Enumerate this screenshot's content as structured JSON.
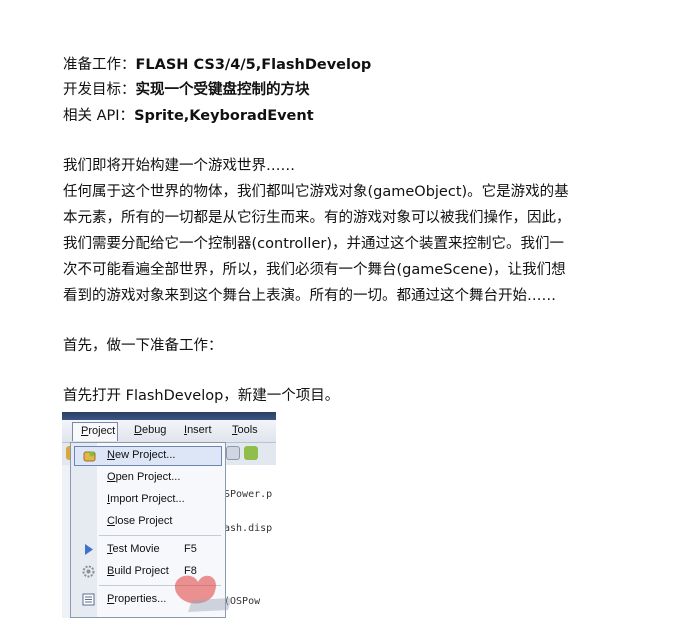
{
  "header": {
    "prep_label": "准备工作：",
    "prep_value": "FLASH CS3/4/5,FlashDevelop",
    "goal_label": "开发目标：",
    "goal_value": "实现一个受键盘控制的方块",
    "api_label": "相关 API：",
    "api_value": "Sprite,KeyboradEvent"
  },
  "intro": [
    "我们即将开始构建一个游戏世界……",
    "任何属于这个世界的物体，我们都叫它游戏对象(gameObject)。它是游戏的基",
    "本元素，所有的一切都是从它衍生而来。有的游戏对象可以被我们操作，因此，",
    "我们需要分配给它一个控制器(controller)，并通过这个装置来控制它。我们一",
    "次不可能看遍全部世界，所以，我们必须有一个舞台(gameScene)，让我们想",
    "看到的游戏对象来到这个舞台上表演。所有的一切。都通过这个舞台开始……"
  ],
  "first_prep": "首先，做一下准备工作：",
  "open_fd": "首先打开 FlashDevelop，新建一个项目。",
  "screenshot": {
    "menubar": {
      "project_first": "P",
      "project_rest": "roject",
      "debug_first": "D",
      "debug_rest": "ebug",
      "insert_first": "I",
      "insert_rest": "nsert",
      "tools_first": "T",
      "tools_rest": "ools"
    },
    "editor_lines": [
      "SPower.p",
      "ash.disp",
      "(OSPow"
    ],
    "menu": {
      "new_first": "N",
      "new_rest": "ew Project...",
      "open_first": "O",
      "open_rest": "pen Project...",
      "import_first": "I",
      "import_rest": "mport Project...",
      "close_first": "C",
      "close_rest": "lose Project",
      "test_first": "T",
      "test_rest": "est Movie",
      "test_shortcut": "F5",
      "build_first": "B",
      "build_rest": "uild Project",
      "build_shortcut": "F8",
      "props_first": "P",
      "props_rest": "roperties..."
    }
  },
  "colors": {
    "menu_highlight": "#dce6f6",
    "title_bar": "#2a3f63"
  }
}
